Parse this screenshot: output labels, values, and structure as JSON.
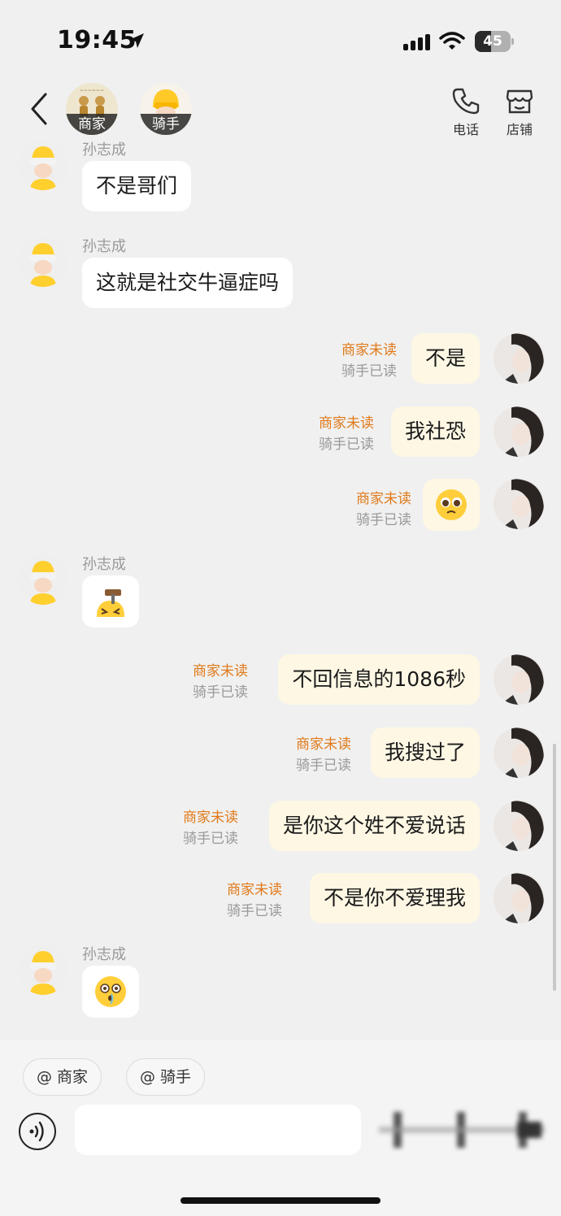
{
  "status_bar": {
    "time": "19:45",
    "battery": "45",
    "battery_level": 0.45
  },
  "header": {
    "merchant_label": "商家",
    "rider_label": "骑手",
    "phone_label": "电话",
    "shop_label": "店铺"
  },
  "messages": [
    {
      "side": "in",
      "name": "孙志成",
      "text": "不是哥们"
    },
    {
      "side": "in",
      "name": "孙志成",
      "text": "这就是社交牛逼症吗"
    },
    {
      "side": "out",
      "text": "不是",
      "merchant_status": "商家未读",
      "rider_status": "骑手已读"
    },
    {
      "side": "out",
      "text": "我社恐",
      "merchant_status": "商家未读",
      "rider_status": "骑手已读"
    },
    {
      "side": "out",
      "text": "🥺",
      "merchant_status": "商家未读",
      "rider_status": "骑手已读"
    },
    {
      "side": "in",
      "name": "孙志成",
      "text": "🔨"
    },
    {
      "side": "out",
      "text": "不回信息的1086秒",
      "merchant_status": "商家未读",
      "rider_status": "骑手已读"
    },
    {
      "side": "out",
      "text": "我搜过了",
      "merchant_status": "商家未读",
      "rider_status": "骑手已读"
    },
    {
      "side": "out",
      "text": "是你这个姓不爱说话",
      "merchant_status": "商家未读",
      "rider_status": "骑手已读"
    },
    {
      "side": "out",
      "text": "不是你不爱理我",
      "merchant_status": "商家未读",
      "rider_status": "骑手已读"
    },
    {
      "side": "in",
      "name": "孙志成",
      "text": "😳"
    }
  ],
  "composer": {
    "mention_merchant": "@ 商家",
    "mention_rider": "@ 骑手",
    "input_value": ""
  },
  "icons": {
    "back": "chevron-left-icon",
    "phone": "phone-icon",
    "shop": "storefront-icon",
    "voice": "voice-wave-icon"
  }
}
